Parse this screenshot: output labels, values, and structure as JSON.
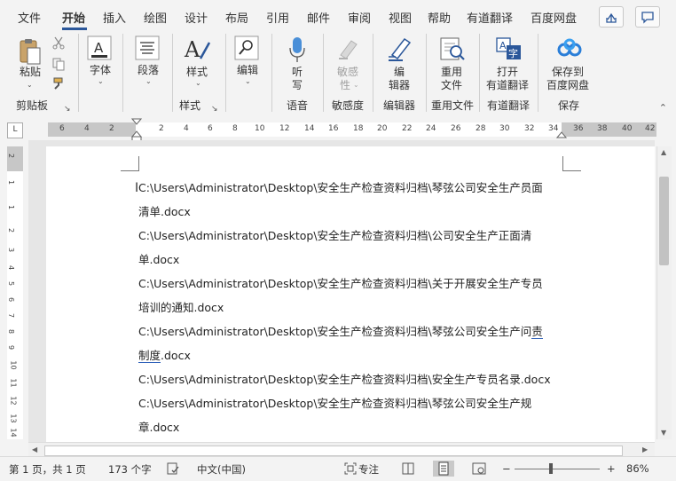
{
  "menu": {
    "tabs": [
      "文件",
      "开始",
      "插入",
      "绘图",
      "设计",
      "布局",
      "引用",
      "邮件",
      "审阅",
      "视图",
      "帮助",
      "有道翻译",
      "百度网盘"
    ],
    "active": "开始"
  },
  "ribbon": {
    "clipboard": {
      "paste": "粘贴",
      "group": "剪贴板"
    },
    "font": {
      "label": "字体"
    },
    "paragraph": {
      "label": "段落"
    },
    "styles": {
      "label": "样式",
      "group": "样式"
    },
    "editing": {
      "label": "编辑"
    },
    "voice": {
      "label1": "听",
      "label2": "写",
      "group": "语音"
    },
    "sensitivity": {
      "label1": "敏感",
      "label2": "性",
      "group": "敏感度"
    },
    "editor": {
      "label1": "编",
      "label2": "辑器",
      "group": "编辑器"
    },
    "reuse": {
      "label1": "重用",
      "label2": "文件",
      "group": "重用文件"
    },
    "youdao": {
      "label1": "打开",
      "label2": "有道翻译",
      "group": "有道翻译"
    },
    "save": {
      "label1": "保存到",
      "label2": "百度网盘",
      "group": "保存"
    }
  },
  "ruler": {
    "tab_selector": "L",
    "h_numbers": [
      "6",
      "4",
      "2",
      "2",
      "4",
      "6",
      "8",
      "10",
      "12",
      "14",
      "16",
      "18",
      "20",
      "22",
      "24",
      "26",
      "28",
      "30",
      "32",
      "34",
      "36",
      "38",
      "40",
      "42"
    ],
    "v_numbers": [
      "2",
      "1",
      "1",
      "2",
      "3",
      "4",
      "5",
      "6",
      "7",
      "8",
      "9",
      "10",
      "11",
      "12",
      "13",
      "14"
    ]
  },
  "document": {
    "lines": [
      "C:\\Users\\Administrator\\Desktop\\安全生产检查资料归档\\琴弦公司安全生产员面",
      "清单.docx",
      "C:\\Users\\Administrator\\Desktop\\安全生产检查资料归档\\公司安全生产正面清",
      "单.docx",
      "C:\\Users\\Administrator\\Desktop\\安全生产检查资料归档\\关于开展安全生产专员",
      "培训的通知.docx",
      "C:\\Users\\Administrator\\Desktop\\安全生产检查资料归档\\琴弦公司安全生产问",
      "责",
      "制度",
      ".docx",
      "C:\\Users\\Administrator\\Desktop\\安全生产检查资料归档\\安全生产专员名录.docx",
      "C:\\Users\\Administrator\\Desktop\\安全生产检查资料归档\\琴弦公司安全生产规",
      "章.docx"
    ]
  },
  "status": {
    "page": "第 1 页，共 1 页",
    "words": "173 个字",
    "language": "中文(中国)",
    "focus": "专注",
    "zoom_minus": "−",
    "zoom_plus": "+",
    "zoom": "86%",
    "zoom_fraction": 0.43
  },
  "colors": {
    "accent": "#2b579a",
    "voice_blue": "#4a8fd8"
  }
}
